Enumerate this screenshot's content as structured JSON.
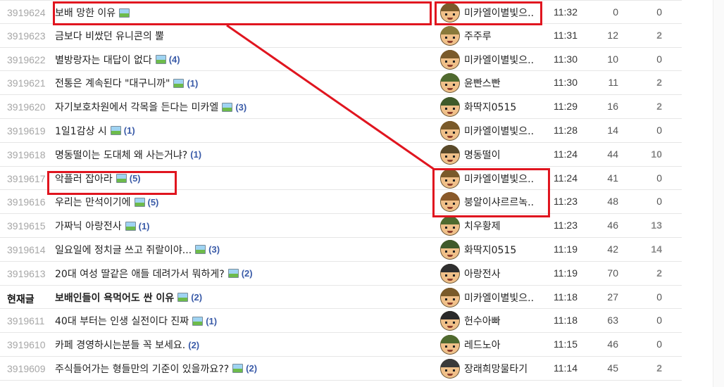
{
  "rows": [
    {
      "num": "3919624",
      "title": "보배 망한 이유",
      "has_image": true,
      "comments": "",
      "author": "미카엘이별빛으..",
      "time": "11:32",
      "views": "0",
      "likes": "0",
      "current": false,
      "hat": "#7a5a2a"
    },
    {
      "num": "3919623",
      "title": "금보다 비쌌던 유니콘의 뿔",
      "has_image": false,
      "comments": "",
      "author": "주주루",
      "time": "11:31",
      "views": "12",
      "likes": "2",
      "current": false,
      "hat": "#8a7a3a"
    },
    {
      "num": "3919622",
      "title": "별방랑자는 대답이 없다",
      "has_image": true,
      "comments": "(4)",
      "author": "미카엘이별빛으..",
      "time": "11:30",
      "views": "10",
      "likes": "0",
      "current": false,
      "hat": "#7a5a2a"
    },
    {
      "num": "3919621",
      "title": "전통은 계속된다 \"대구니까\"",
      "has_image": true,
      "comments": "(1)",
      "author": "윤빤스빤",
      "time": "11:30",
      "views": "11",
      "likes": "2",
      "current": false,
      "hat": "#4f6a2f"
    },
    {
      "num": "3919620",
      "title": "자기보호차원에서 각목을 든다는 미카엘",
      "has_image": true,
      "comments": "(3)",
      "author": "화딱지0515",
      "time": "11:29",
      "views": "16",
      "likes": "2",
      "current": false,
      "hat": "#3f5a2a"
    },
    {
      "num": "3919619",
      "title": "1일1감상 시",
      "has_image": true,
      "comments": "(1)",
      "author": "미카엘이별빛으..",
      "time": "11:28",
      "views": "14",
      "likes": "0",
      "current": false,
      "hat": "#7a5a2a"
    },
    {
      "num": "3919618",
      "title": "명동떨이는 도대체 왜 사는거냐?",
      "has_image": false,
      "comments": "(1)",
      "author": "명동떨이",
      "time": "11:24",
      "views": "44",
      "likes": "10",
      "current": false,
      "hat": "#5a4a2a"
    },
    {
      "num": "3919617",
      "title": "악플러 잡아라",
      "has_image": true,
      "comments": "(5)",
      "author": "미카엘이별빛으..",
      "time": "11:24",
      "views": "41",
      "likes": "0",
      "current": false,
      "hat": "#7a5a2a"
    },
    {
      "num": "3919616",
      "title": "우리는 만석이기에",
      "has_image": true,
      "comments": "(5)",
      "author": "붕알이샤르르녹..",
      "time": "11:23",
      "views": "48",
      "likes": "0",
      "current": false,
      "hat": "#8a5a2a"
    },
    {
      "num": "3919615",
      "title": "가짜닉 아랑전사",
      "has_image": true,
      "comments": "(1)",
      "author": "치우황제",
      "time": "11:23",
      "views": "46",
      "likes": "13",
      "current": false,
      "hat": "#4f6a2f"
    },
    {
      "num": "3919614",
      "title": "일요일에 정치글 쓰고 쥐랄이야...",
      "has_image": true,
      "comments": "(3)",
      "author": "화딱지0515",
      "time": "11:19",
      "views": "42",
      "likes": "14",
      "current": false,
      "hat": "#3f5a2a"
    },
    {
      "num": "3919613",
      "title": "20대 여성 딸같은 애들 데려가서 뭐하게?",
      "has_image": true,
      "comments": "(2)",
      "author": "아랑전사",
      "time": "11:19",
      "views": "70",
      "likes": "2",
      "current": false,
      "hat": "#2f2f2f"
    },
    {
      "num": "현재글",
      "title": "보배인들이 욕먹어도 싼 이유",
      "has_image": true,
      "comments": "(2)",
      "author": "미카엘이별빛으..",
      "time": "11:18",
      "views": "27",
      "likes": "0",
      "current": true,
      "hat": "#7a5a2a"
    },
    {
      "num": "3919611",
      "title": "40대 부터는 인생 실전이다 진짜",
      "has_image": true,
      "comments": "(1)",
      "author": "헌수아빠",
      "time": "11:18",
      "views": "63",
      "likes": "0",
      "current": false,
      "hat": "#2a2a2a"
    },
    {
      "num": "3919610",
      "title": "카페 경영하시는분들 꼭 보세요.",
      "has_image": false,
      "comments": "(2)",
      "author": "레드노아",
      "time": "11:15",
      "views": "46",
      "likes": "0",
      "current": false,
      "hat": "#4f6a2f"
    },
    {
      "num": "3919609",
      "title": "주식들어가는 형들만의 기준이 있을까요??",
      "has_image": true,
      "comments": "(2)",
      "author": "장래희망물타기",
      "time": "11:14",
      "views": "45",
      "likes": "2",
      "current": false,
      "hat": "#3a3a3a"
    }
  ],
  "colors": {
    "highlight": "#e0151f",
    "comment_count": "#3a5ba8",
    "number": "#a7a7a7"
  }
}
